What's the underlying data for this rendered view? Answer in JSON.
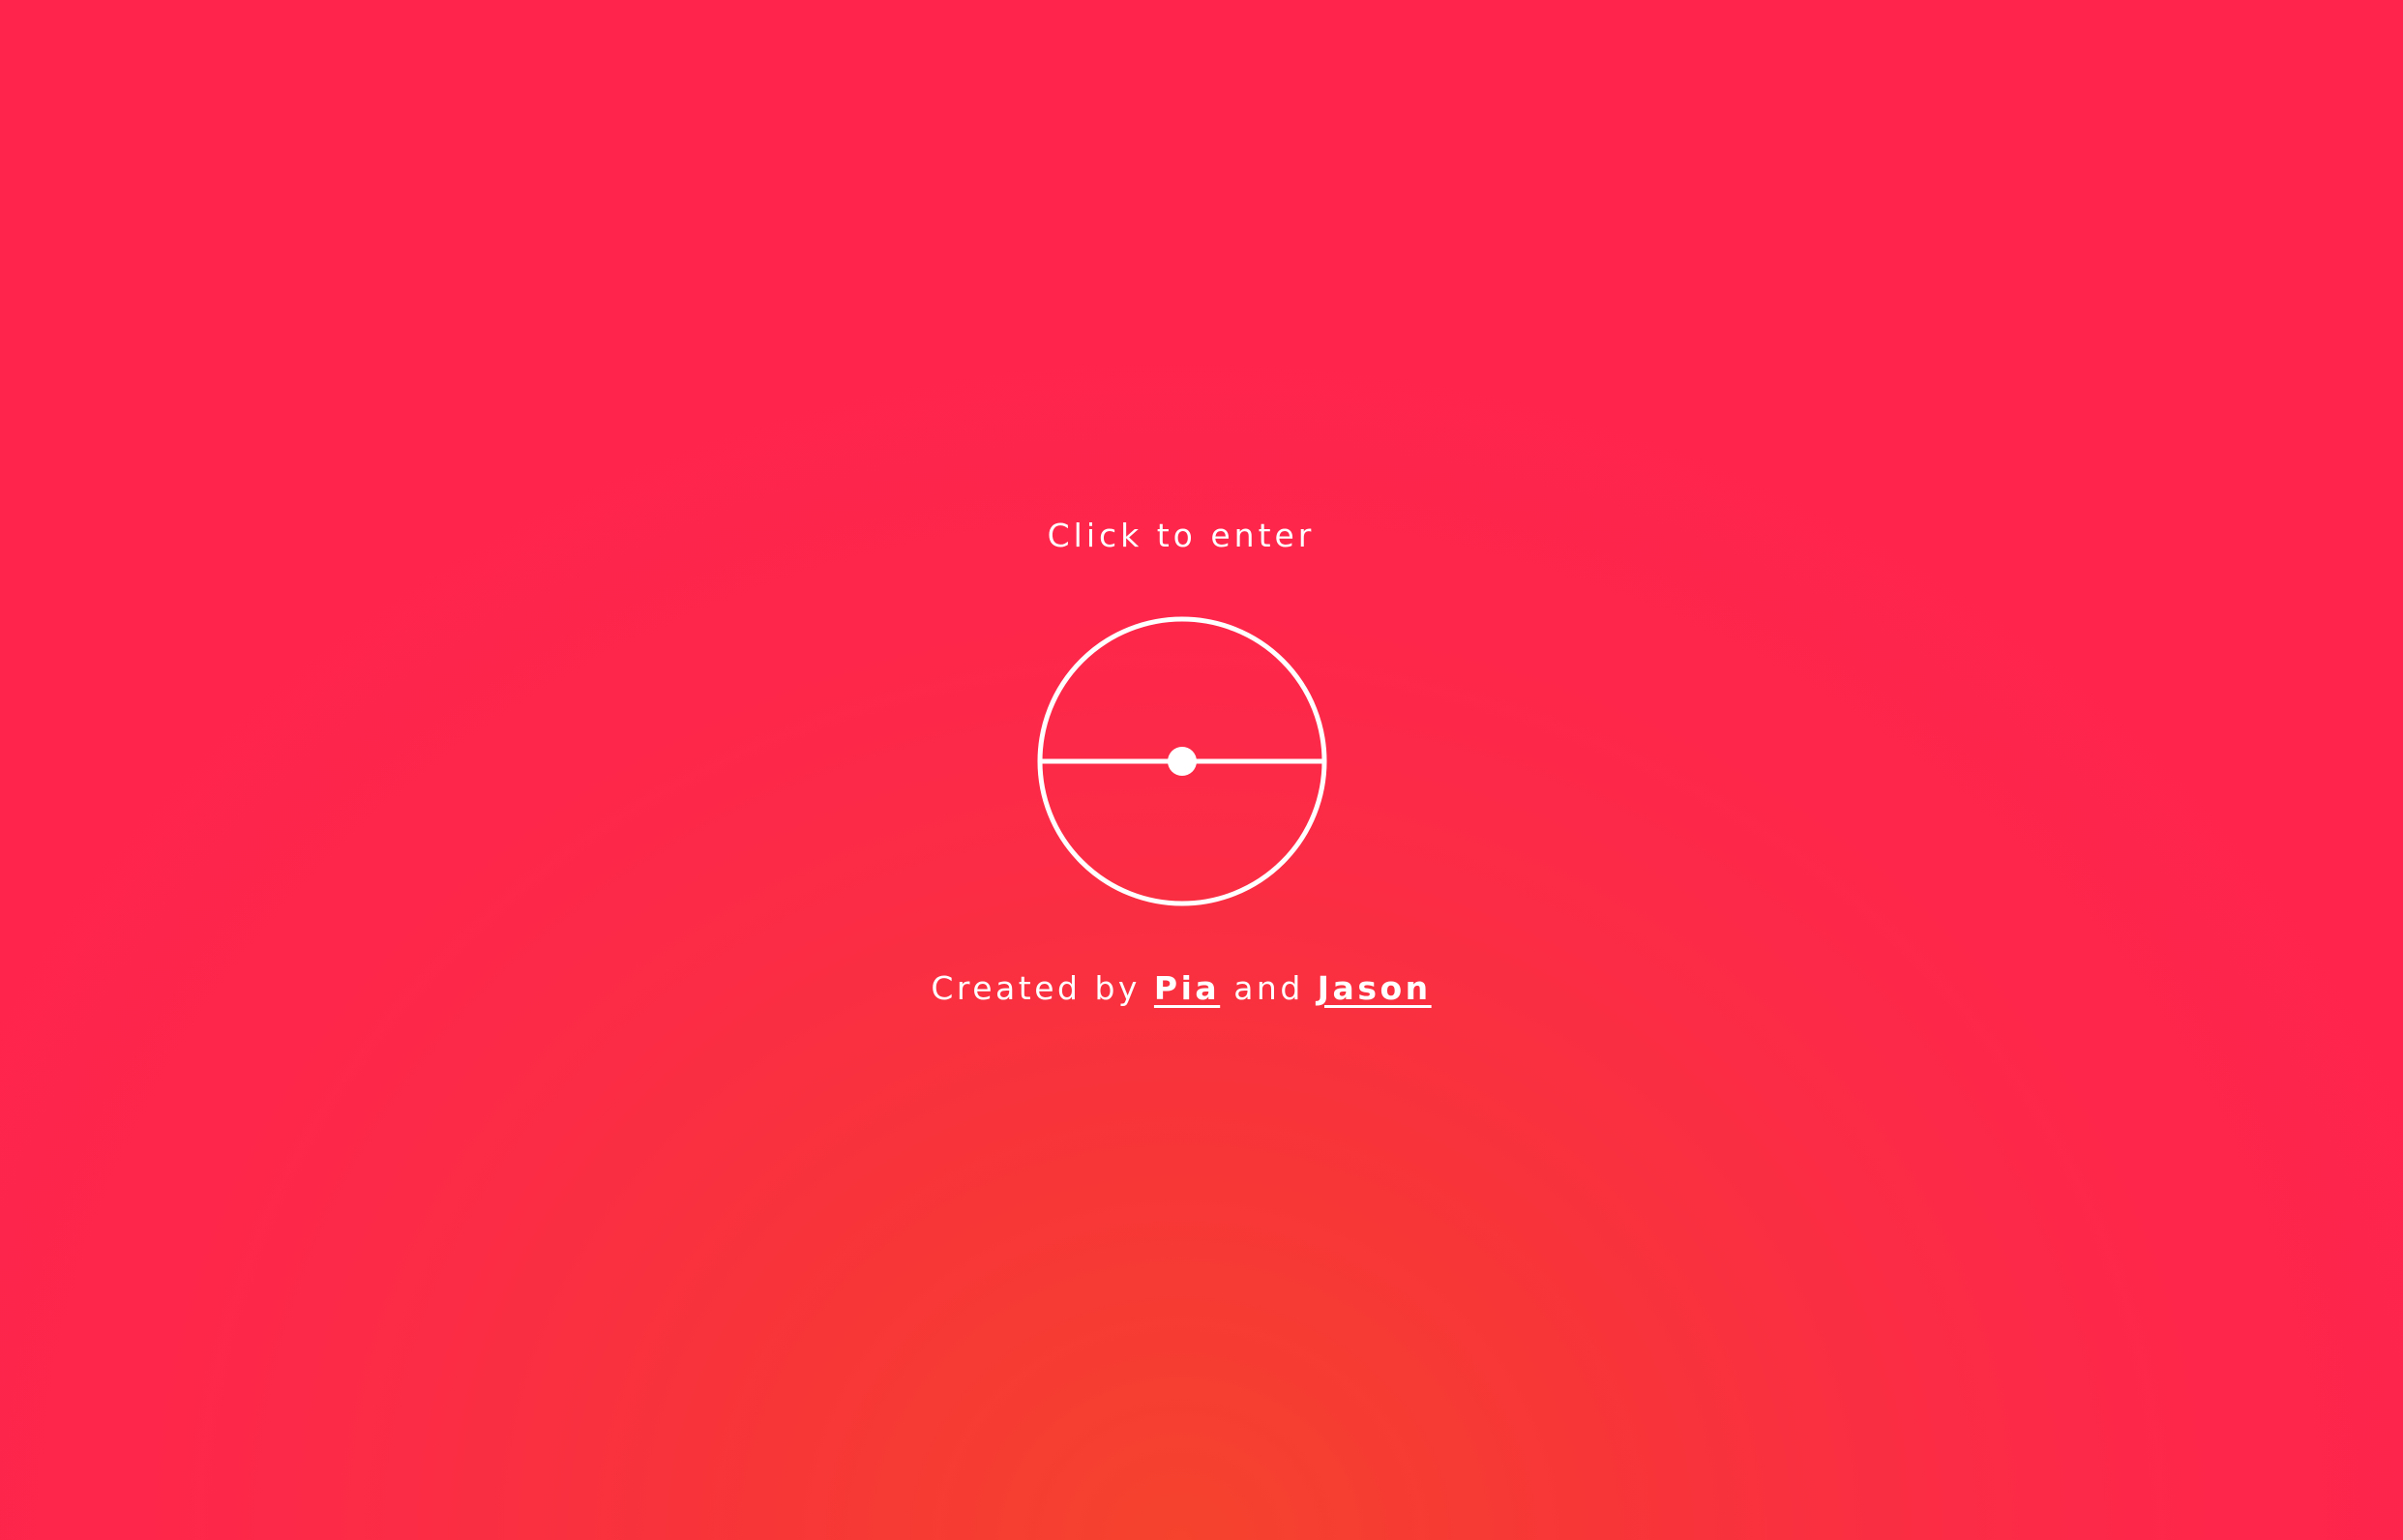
{
  "intro": {
    "enter_label": "Click to enter"
  },
  "logo": {
    "icon": "circle-horizon-icon",
    "color": "#ffffff"
  },
  "credits": {
    "prefix": "Created by ",
    "author1": "Pia",
    "conjunction": " and ",
    "author2": "Jason"
  },
  "colors": {
    "background_edge": "#ff244c",
    "background_center": "#f5432d",
    "foreground": "#ffffff"
  }
}
